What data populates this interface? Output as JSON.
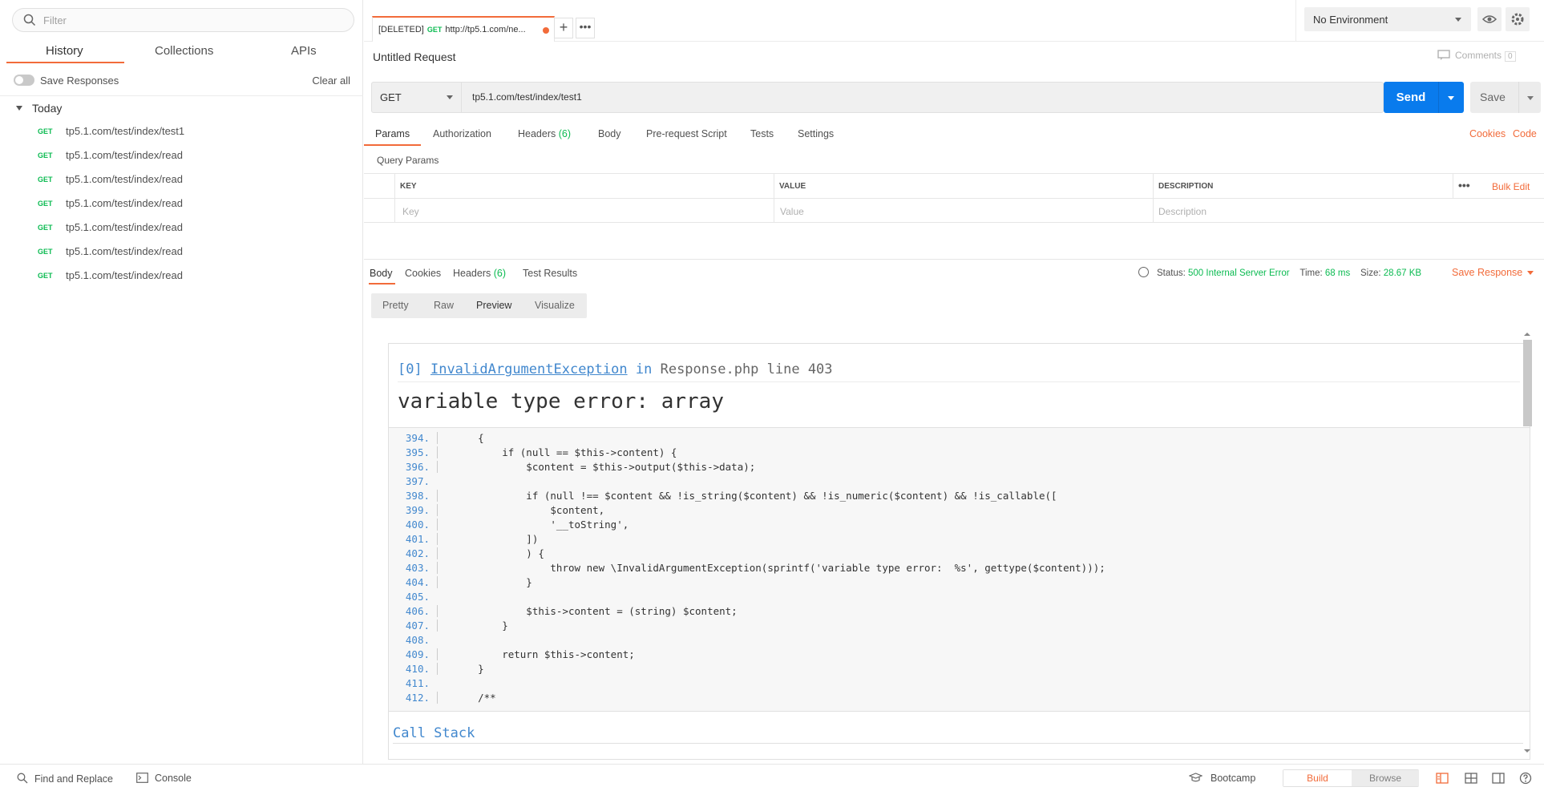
{
  "sidebar": {
    "filter_placeholder": "Filter",
    "tabs": [
      "History",
      "Collections",
      "APIs"
    ],
    "save_responses_label": "Save Responses",
    "clear_all_label": "Clear all",
    "group_label": "Today",
    "history": [
      {
        "method": "GET",
        "url": "tp5.1.com/test/index/test1"
      },
      {
        "method": "GET",
        "url": "tp5.1.com/test/index/read"
      },
      {
        "method": "GET",
        "url": "tp5.1.com/test/index/read"
      },
      {
        "method": "GET",
        "url": "tp5.1.com/test/index/read"
      },
      {
        "method": "GET",
        "url": "tp5.1.com/test/index/read"
      },
      {
        "method": "GET",
        "url": "tp5.1.com/test/index/read"
      },
      {
        "method": "GET",
        "url": "tp5.1.com/test/index/read"
      }
    ]
  },
  "tab": {
    "prefix": "[DELETED]",
    "method": "GET",
    "url": "http://tp5.1.com/ne..."
  },
  "environment": {
    "selected": "No Environment"
  },
  "request": {
    "title": "Untitled Request",
    "comments_label": "Comments",
    "comments_count": "0",
    "method": "GET",
    "url": "tp5.1.com/test/index/test1",
    "send_label": "Send",
    "save_label": "Save",
    "tabs": {
      "params": "Params",
      "authorization": "Authorization",
      "headers": "Headers",
      "headers_count": "(6)",
      "body": "Body",
      "prerequest": "Pre-request Script",
      "tests": "Tests",
      "settings": "Settings"
    },
    "cookies_label": "Cookies",
    "code_label": "Code",
    "query_params_label": "Query Params",
    "table": {
      "headers": [
        "KEY",
        "VALUE",
        "DESCRIPTION"
      ],
      "placeholders": [
        "Key",
        "Value",
        "Description"
      ],
      "bulk_edit": "Bulk Edit",
      "more": "•••"
    }
  },
  "response": {
    "tabs": {
      "body": "Body",
      "cookies": "Cookies",
      "headers": "Headers",
      "headers_count": "(6)",
      "test_results": "Test Results"
    },
    "status_label": "Status:",
    "status_value": "500 Internal Server Error",
    "time_label": "Time:",
    "time_value": "68 ms",
    "size_label": "Size:",
    "size_value": "28.67 KB",
    "save_response_label": "Save Response",
    "view_modes": [
      "Pretty",
      "Raw",
      "Preview",
      "Visualize"
    ],
    "preview": {
      "exception_index": "[0]",
      "exception_class": "InvalidArgumentException",
      "in_word": "in",
      "file": "Response.php line 403",
      "message": "variable type error:  array",
      "code_lines": [
        {
          "n": "394.",
          "c": "    {"
        },
        {
          "n": "395.",
          "c": "        if (null == $this->content) {"
        },
        {
          "n": "396.",
          "c": "            $content = $this->output($this->data);"
        },
        {
          "n": "397.",
          "c": ""
        },
        {
          "n": "398.",
          "c": "            if (null !== $content && !is_string($content) && !is_numeric($content) && !is_callable(["
        },
        {
          "n": "399.",
          "c": "                $content,"
        },
        {
          "n": "400.",
          "c": "                '__toString',"
        },
        {
          "n": "401.",
          "c": "            ])"
        },
        {
          "n": "402.",
          "c": "            ) {"
        },
        {
          "n": "403.",
          "c": "                throw new \\InvalidArgumentException(sprintf('variable type error:  %s', gettype($content)));"
        },
        {
          "n": "404.",
          "c": "            }"
        },
        {
          "n": "405.",
          "c": ""
        },
        {
          "n": "406.",
          "c": "            $this->content = (string) $content;"
        },
        {
          "n": "407.",
          "c": "        }"
        },
        {
          "n": "408.",
          "c": ""
        },
        {
          "n": "409.",
          "c": "        return $this->content;"
        },
        {
          "n": "410.",
          "c": "    }"
        },
        {
          "n": "411.",
          "c": ""
        },
        {
          "n": "412.",
          "c": "    /**"
        }
      ],
      "call_stack_label": "Call Stack"
    }
  },
  "statusbar": {
    "find_replace": "Find and Replace",
    "console": "Console",
    "bootcamp": "Bootcamp",
    "build": "Build",
    "browse": "Browse"
  },
  "colors": {
    "accent": "#f26b3a",
    "send": "#097bed",
    "get": "#0cbb52",
    "link_blue": "#4288ce"
  }
}
